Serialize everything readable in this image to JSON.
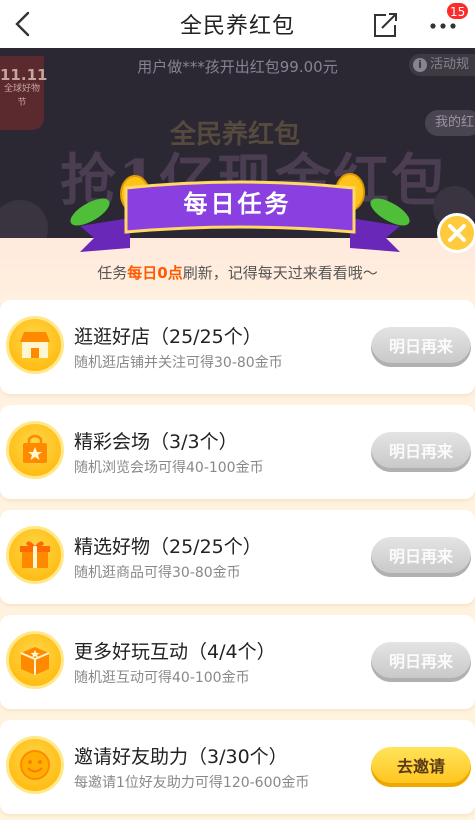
{
  "nav": {
    "title": "全民养红包",
    "back_icon": "back-chevron-icon",
    "share_icon": "share-icon",
    "more_icon": "more-dots-icon",
    "badge_count": "15"
  },
  "banner": {
    "ticker": "用户做***孩开出红包99.00元",
    "activity_label": "活动规",
    "tag_1111": "11.11",
    "tag_1111_sub": "全球好物节",
    "brand_small": "全民养红包",
    "headline": "抢1亿现金红包",
    "my_label": "我的红"
  },
  "popup": {
    "title": "每日任务",
    "subtitle_prefix": "任务",
    "subtitle_highlight": "每日0点",
    "subtitle_suffix": "刷新，记得每天过来看看哦～",
    "close_icon": "close-icon"
  },
  "tasks": [
    {
      "name": "逛逛好店（25/25个）",
      "desc": "随机逛店铺并关注可得30-80金币",
      "button": "明日再来",
      "icon": "shop-icon"
    },
    {
      "name": "精彩会场（3/3个）",
      "desc": "随机浏览会场可得40-100金币",
      "button": "明日再来",
      "icon": "shopping-bag-icon"
    },
    {
      "name": "精选好物（25/25个）",
      "desc": "随机逛商品可得30-80金币",
      "button": "明日再来",
      "icon": "gift-box-icon"
    },
    {
      "name": "更多好玩互动（4/4个）",
      "desc": "随机逛互动可得40-100金币",
      "button": "明日再来",
      "icon": "package-icon"
    },
    {
      "name": "邀请好友助力（3/30个）",
      "desc": "每邀请1位好友助力可得120-600金币",
      "button": "去邀请",
      "icon": "smiley-icon"
    }
  ],
  "colors": {
    "accent": "#ff5a00",
    "ribbon": "#8a3fe0",
    "coin_yellow": "#ffc21a",
    "disabled_button": "#c6c6c6"
  }
}
